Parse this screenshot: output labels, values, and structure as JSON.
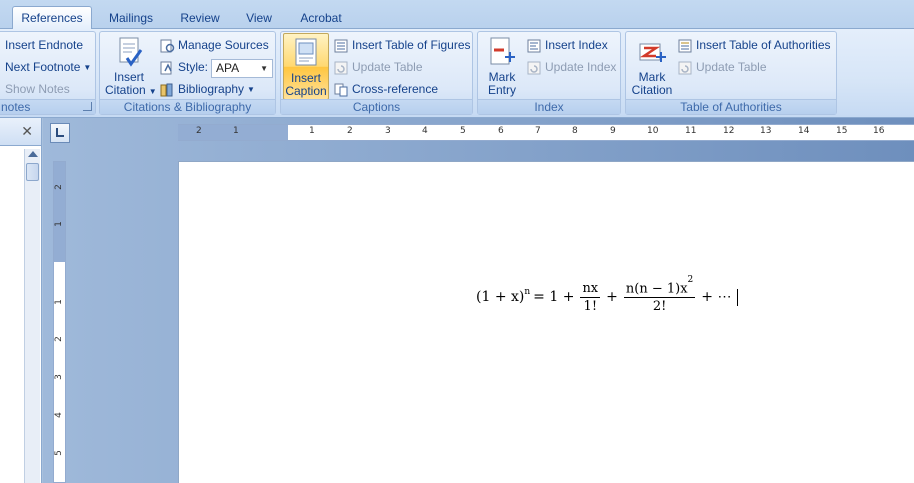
{
  "tabs": [
    {
      "label": "References",
      "active": true
    },
    {
      "label": "Mailings"
    },
    {
      "label": "Review"
    },
    {
      "label": "View"
    },
    {
      "label": "Acrobat"
    }
  ],
  "footnotes": {
    "insert_endnote": "Insert Endnote",
    "next_footnote": "Next Footnote",
    "show_notes": "Show Notes",
    "label": "notes"
  },
  "citations": {
    "insert_citation": [
      "Insert",
      "Citation"
    ],
    "manage_sources": "Manage Sources",
    "style_label": "Style:",
    "style_value": "APA",
    "bibliography": "Bibliography",
    "label": "Citations & Bibliography"
  },
  "captions": {
    "insert_caption": [
      "Insert",
      "Caption"
    ],
    "insert_table_of_figures": "Insert Table of Figures",
    "update_table": "Update Table",
    "cross_reference": "Cross-reference",
    "label": "Captions"
  },
  "index": {
    "mark_entry": [
      "Mark",
      "Entry"
    ],
    "insert_index": "Insert Index",
    "update_index": "Update Index",
    "label": "Index"
  },
  "authorities": {
    "mark_citation": [
      "Mark",
      "Citation"
    ],
    "insert_table_of_authorities": "Insert Table of Authorities",
    "update_table": "Update Table",
    "label": "Table of Authorities"
  },
  "ruler": {
    "h_ticks": [
      "2",
      "1",
      "1",
      "2",
      "3",
      "4",
      "5",
      "6",
      "7",
      "8",
      "9",
      "10",
      "11",
      "12",
      "13",
      "14",
      "15",
      "16"
    ],
    "v_ticks": [
      "2",
      "1",
      "1",
      "2",
      "3",
      "4",
      "5"
    ]
  },
  "equation": {
    "lhs": "(1 + x)",
    "lhs_exp": "n",
    "eq": "= 1 +",
    "f1_num": "nx",
    "f1_den": "1!",
    "plus": "+",
    "f2_num": "n(n − 1)x",
    "f2_num_exp": "2",
    "f2_den": "2!",
    "tail": "+ ⋯"
  },
  "colors": {
    "ribbon_text": "#15428b",
    "active_button": "#ffd870",
    "doc_background": "#6e8fbd"
  }
}
